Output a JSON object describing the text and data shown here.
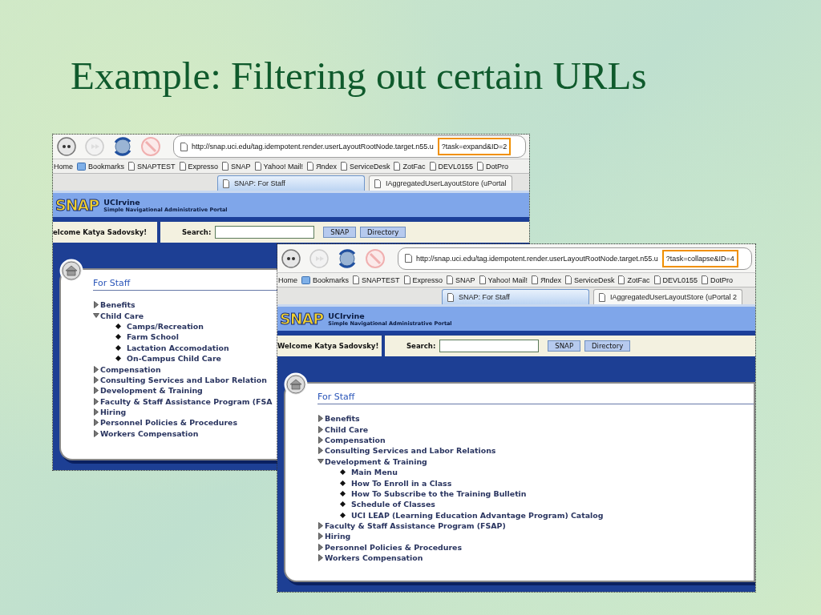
{
  "slide": {
    "title": "Example: Filtering out certain URLs"
  },
  "screenshots": [
    {
      "url": "http://snap.uci.edu/tag.idempotent.render.userLayoutRootNode.target.n55.u",
      "url_highlight": "?task=expand&ID=2",
      "bookmarks": [
        "Home",
        "Bookmarks",
        "SNAPTEST",
        "Expresso",
        "SNAP",
        "Yahoo! Mail!",
        "Яndex",
        "ServiceDesk",
        "ZotFac",
        "DEVL0155",
        "DotPro"
      ],
      "tabs": [
        {
          "label": "SNAP: For Staff",
          "selected": true
        },
        {
          "label": "IAggregatedUserLayoutStore (uPortal",
          "selected": false
        }
      ],
      "banner": {
        "logo": "SNAP",
        "org": "UCIrvine",
        "subtitle": "Simple Navigational Administrative Portal"
      },
      "welcome": "elcome Katya Sadovsky!",
      "search_label": "Search:",
      "buttons": [
        "SNAP",
        "Directory"
      ],
      "portlet": {
        "title": "For Staff",
        "items": [
          {
            "label": "Benefits",
            "expanded": false
          },
          {
            "label": "Child Care",
            "expanded": true,
            "children": [
              "Camps/Recreation",
              "Farm School",
              "Lactation Accomodation",
              "On-Campus Child Care"
            ]
          },
          {
            "label": "Compensation",
            "expanded": false
          },
          {
            "label": "Consulting Services and Labor Relation",
            "expanded": false
          },
          {
            "label": "Development & Training",
            "expanded": false
          },
          {
            "label": "Faculty & Staff Assistance Program (FSA",
            "expanded": false
          },
          {
            "label": "Hiring",
            "expanded": false
          },
          {
            "label": "Personnel Policies & Procedures",
            "expanded": false
          },
          {
            "label": "Workers Compensation",
            "expanded": false
          }
        ]
      }
    },
    {
      "url": "http://snap.uci.edu/tag.idempotent.render.userLayoutRootNode.target.n55.u",
      "url_highlight": "?task=collapse&ID=4",
      "bookmarks": [
        "Home",
        "Bookmarks",
        "SNAPTEST",
        "Expresso",
        "SNAP",
        "Yahoo! Mail!",
        "Яndex",
        "ServiceDesk",
        "ZotFac",
        "DEVL0155",
        "DotPro"
      ],
      "tabs": [
        {
          "label": "SNAP: For Staff",
          "selected": true
        },
        {
          "label": "IAggregatedUserLayoutStore (uPortal 2",
          "selected": false
        }
      ],
      "banner": {
        "logo": "SNAP",
        "org": "UCIrvine",
        "subtitle": "Simple Navigational Administrative Portal"
      },
      "welcome": "Welcome Katya Sadovsky!",
      "search_label": "Search:",
      "buttons": [
        "SNAP",
        "Directory"
      ],
      "portlet": {
        "title": "For Staff",
        "items": [
          {
            "label": "Benefits",
            "expanded": false
          },
          {
            "label": "Child Care",
            "expanded": false
          },
          {
            "label": "Compensation",
            "expanded": false
          },
          {
            "label": "Consulting Services and Labor Relations",
            "expanded": false
          },
          {
            "label": "Development & Training",
            "expanded": true,
            "children": [
              "Main Menu",
              "How To Enroll in a Class",
              "How To Subscribe to the Training Bulletin",
              "Schedule of Classes",
              "UCI LEAP (Learning Education Advantage Program) Catalog"
            ]
          },
          {
            "label": "Faculty & Staff Assistance Program (FSAP)",
            "expanded": false
          },
          {
            "label": "Hiring",
            "expanded": false
          },
          {
            "label": "Personnel Policies & Procedures",
            "expanded": false
          },
          {
            "label": "Workers Compensation",
            "expanded": false
          }
        ]
      }
    }
  ]
}
